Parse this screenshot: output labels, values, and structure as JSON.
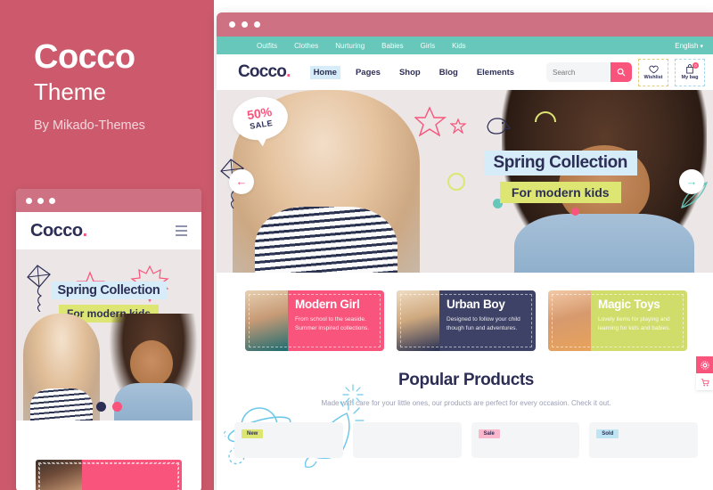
{
  "promo_panel": {
    "title": "Cocco",
    "subtitle": "Theme",
    "author": "By Mikado-Themes"
  },
  "colors": {
    "panel_bg": "#cc5a6c",
    "titlebar": "#cd7183",
    "pink": "#f8547c",
    "navy": "#2d2e55",
    "teal": "#66c7ba",
    "lime": "#dde673",
    "lightblue": "#d6ecf8"
  },
  "mobile_preview": {
    "logo": "Cocco",
    "logo_dot": ".",
    "menu_icon": "hamburger-icon",
    "hero": {
      "heading": "Spring Collection",
      "subheading": "For modern kids"
    },
    "slider_dots": 2
  },
  "browser": {
    "window_dots": 3,
    "topbar": {
      "links": [
        "Outfits",
        "Clothes",
        "Nurturing",
        "Babies",
        "Girls",
        "Kids"
      ],
      "language": "English",
      "caret": "▾"
    },
    "nav": {
      "logo": "Cocco",
      "logo_dot": ".",
      "links": [
        {
          "label": "Home",
          "active": true
        },
        {
          "label": "Pages",
          "active": false
        },
        {
          "label": "Shop",
          "active": false
        },
        {
          "label": "Blog",
          "active": false
        },
        {
          "label": "Elements",
          "active": false
        }
      ],
      "search": {
        "placeholder": "Search",
        "button_icon": "search-icon"
      },
      "wishlist": {
        "icon": "heart-icon",
        "label": "Wishlist"
      },
      "bag": {
        "icon": "bag-icon",
        "label": "My bag",
        "count": "0"
      }
    },
    "hero": {
      "sale_badge": {
        "percent": "50%",
        "word": "SALE"
      },
      "heading": "Spring Collection",
      "subheading": "For modern kids",
      "prev_icon": "arrow-left-icon",
      "prev_glyph": "←",
      "next_icon": "arrow-right-icon",
      "next_glyph": "→"
    },
    "promo_cards": [
      {
        "title": "Modern Girl",
        "desc": "From school to the seaside. Summer inspired collections.",
        "color": "#f8547c"
      },
      {
        "title": "Urban Boy",
        "desc": "Designed to follow your child though fun and adventures.",
        "color": "#3e4267"
      },
      {
        "title": "Magic Toys",
        "desc": "Lovely items for playing and learning for kids and babies.",
        "color": "#d0dd6b"
      }
    ],
    "products": {
      "title": "Popular Products",
      "subtitle": "Made with care for your little ones, our products are perfect for every occasion. Check it out.",
      "items": [
        {
          "badge": "New"
        },
        {
          "badge": ""
        },
        {
          "badge": "Sale"
        },
        {
          "badge": "Sold"
        }
      ]
    },
    "side_buttons": [
      {
        "icon": "settings-icon",
        "glyph": "⚙"
      },
      {
        "icon": "cart-icon",
        "glyph": "Ὥ2"
      }
    ]
  }
}
